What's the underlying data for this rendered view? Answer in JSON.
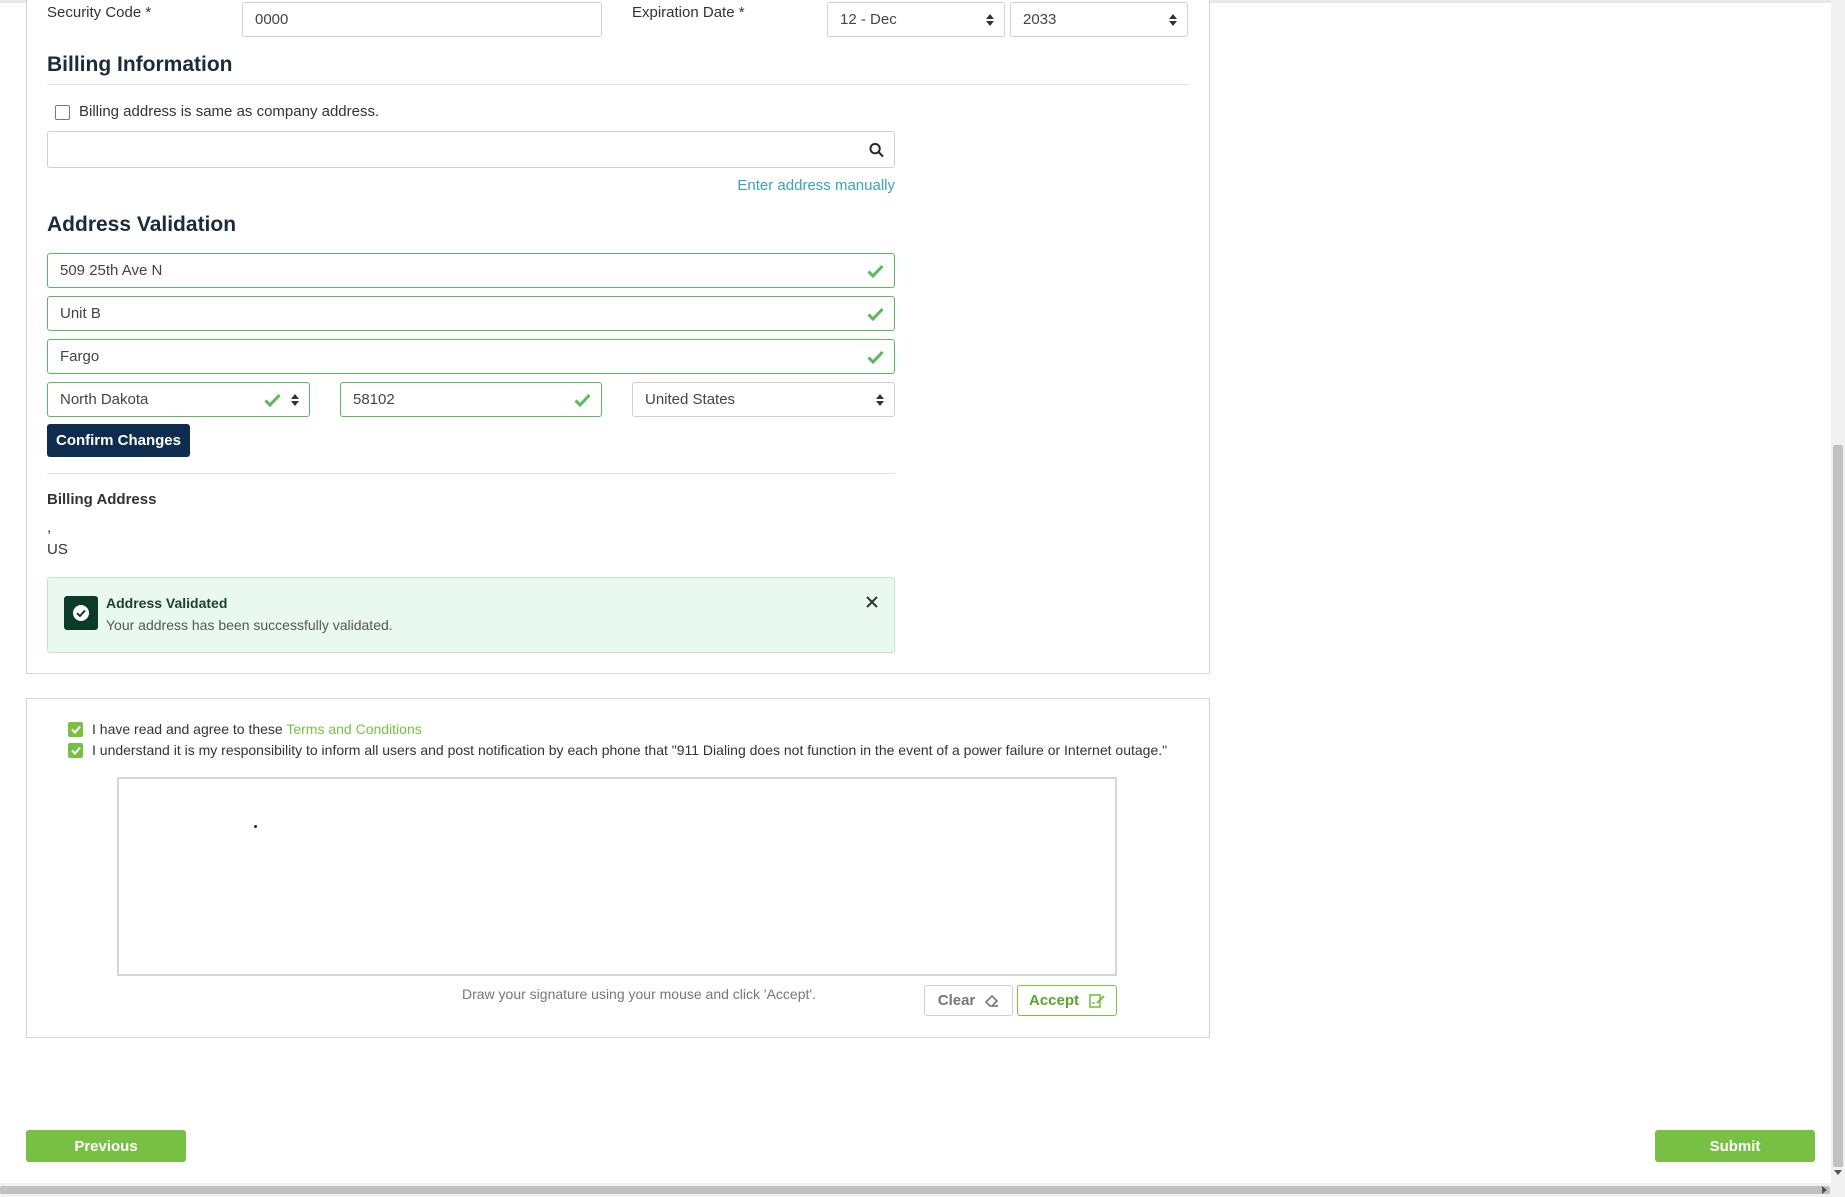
{
  "payment": {
    "security_code_label": "Security Code *",
    "security_code_value": "0000",
    "expiration_label": "Expiration Date *",
    "exp_month": "12 - Dec",
    "exp_year": "2033"
  },
  "billing": {
    "heading": "Billing Information",
    "same_as_company_label": "Billing address is same as company address.",
    "search_value": "",
    "enter_manually_link": "Enter address manually"
  },
  "validation": {
    "heading": "Address Validation",
    "street": "509 25th Ave N",
    "unit": "Unit B",
    "city": "Fargo",
    "state": "North Dakota",
    "zip": "58102",
    "country": "United States",
    "confirm_button": "Confirm Changes"
  },
  "billing_address": {
    "title": "Billing Address",
    "line1": ",",
    "line2": "US"
  },
  "alert": {
    "title": "Address Validated",
    "message": "Your address has been successfully validated."
  },
  "agreements": {
    "terms_prefix": "I have read and agree to these ",
    "terms_link": "Terms and Conditions",
    "e911_text": "I understand it is my responsibility to inform all users and post notification by each phone that \"911 Dialing does not function in the event of a power failure or Internet outage.\""
  },
  "signature": {
    "hint": "Draw your signature using your mouse and click 'Accept'.",
    "clear_label": "Clear",
    "accept_label": "Accept"
  },
  "nav": {
    "previous_label": "Previous",
    "submit_label": "Submit"
  },
  "colors": {
    "accent_green": "#78c043",
    "valid_green": "#5cb85c",
    "dark_navy": "#0e2d4e",
    "link_teal": "#3aa3b7",
    "alert_bg": "#e9f9f0"
  }
}
